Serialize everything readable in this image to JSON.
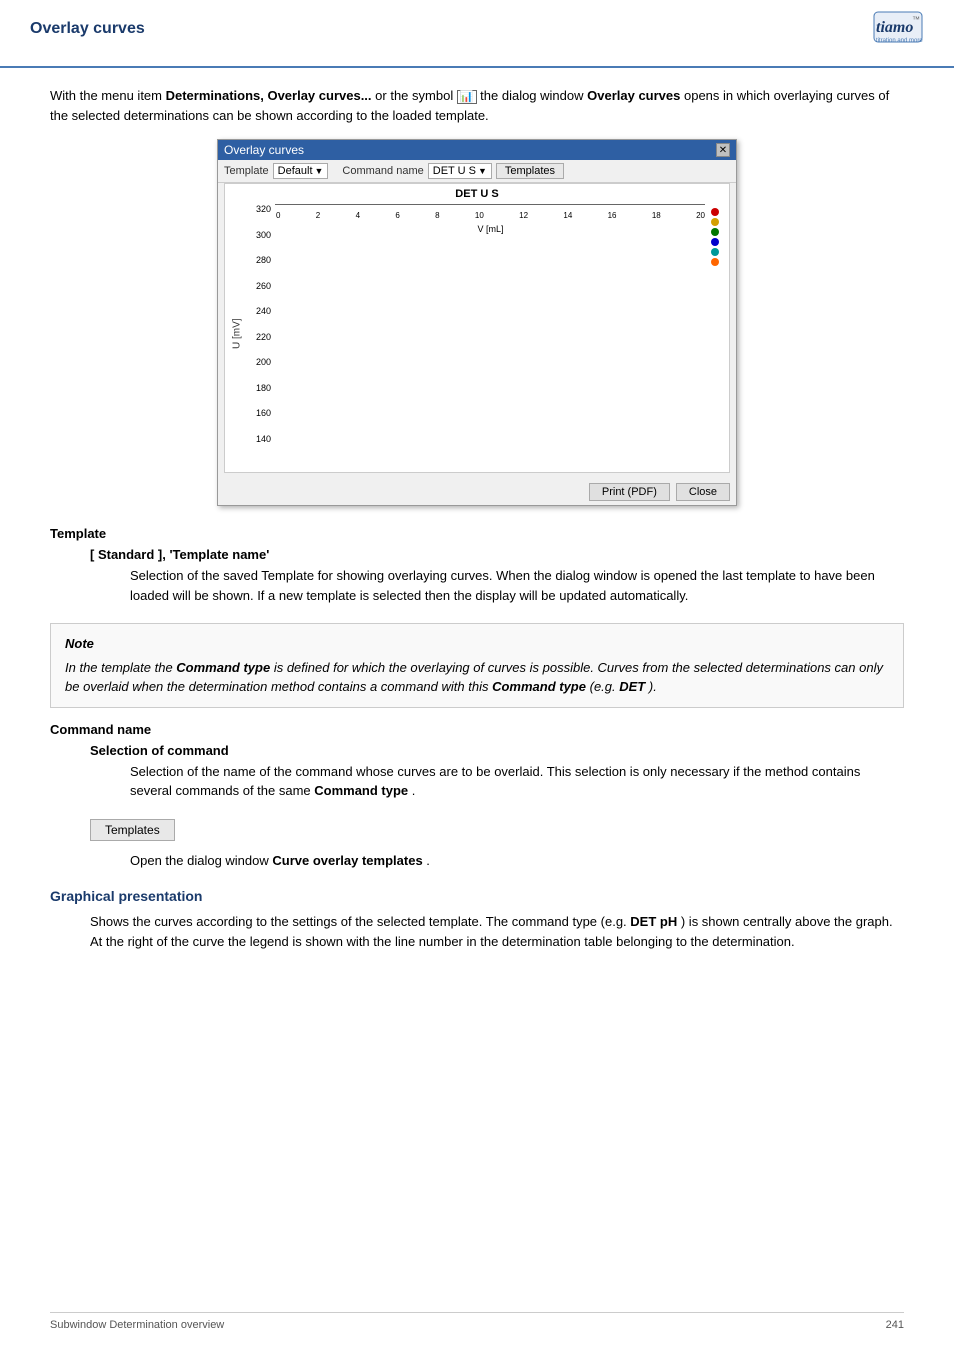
{
  "header": {
    "title": "Overlay curves"
  },
  "logo": {
    "brand": "tiamo",
    "tagline": "titration and more"
  },
  "content": {
    "intro": {
      "text_before_bold": "With the menu item ",
      "bold1": "Determinations, Overlay curves...",
      "text_mid": " or the symbol ",
      "text_after": " the dialog window ",
      "bold2": "Overlay curves",
      "text_end": " opens in which overlaying curves of the selected determinations can be shown according to the loaded template."
    },
    "dialog": {
      "title": "Overlay curves",
      "toolbar": {
        "template_label": "Template",
        "template_value": "Default",
        "command_name_label": "Command name",
        "command_name_value": "DET U S",
        "templates_btn": "Templates"
      },
      "chart_title": "DET U S",
      "chart_y_label": "U [mV]",
      "chart_x_label": "V [mL]",
      "chart_y_values": [
        "320",
        "300",
        "280",
        "260",
        "240",
        "220",
        "200",
        "180",
        "160",
        "140"
      ],
      "chart_x_values": [
        "0",
        "2",
        "4",
        "6",
        "8",
        "10",
        "12",
        "14",
        "16",
        "18",
        "20"
      ],
      "legend_colors": [
        "#ff0000",
        "#ffd700",
        "#00aa00",
        "#0000ff",
        "#00aaaa",
        "#ff6600"
      ],
      "footer": {
        "print_btn": "Print (PDF)",
        "close_btn": "Close"
      }
    },
    "template_section": {
      "heading": "Template",
      "sub_heading": "[ Standard ], 'Template name'",
      "description": "Selection of the saved Template for showing overlaying curves. When the dialog window is opened the last template to have been loaded will be shown. If a new template is selected then the display will be updated automatically."
    },
    "note": {
      "title": "Note",
      "text_pre": "In the template the ",
      "bold1": "Command type",
      "text_mid": " is defined for which the overlaying of curves is possible. Curves from the selected determinations can only be overlaid when the determination method contains a command with this ",
      "bold2": "Command type",
      "text_post": " (e.g. ",
      "bold3": "DET",
      "text_end": ")."
    },
    "command_name_section": {
      "heading": "Command name",
      "sub_heading": "Selection of command",
      "description": "Selection of the name of the command whose curves are to be overlaid. This selection is only necessary if the method contains several commands of the same ",
      "bold": "Command type",
      "description_end": "."
    },
    "templates_button": {
      "label": "Templates",
      "desc_pre": "Open the dialog window ",
      "desc_bold": "Curve overlay templates",
      "desc_end": "."
    },
    "graphical_section": {
      "heading": "Graphical presentation",
      "text_pre": "Shows the curves according to the settings of the selected template. The command type (e.g. ",
      "bold1": "DET pH",
      "text_mid": ") is shown centrally above the graph. At the right of the curve the legend is shown with the line number in the determination table belonging to the determination."
    }
  },
  "footer": {
    "left": "Subwindow Determination overview",
    "right": "241"
  }
}
